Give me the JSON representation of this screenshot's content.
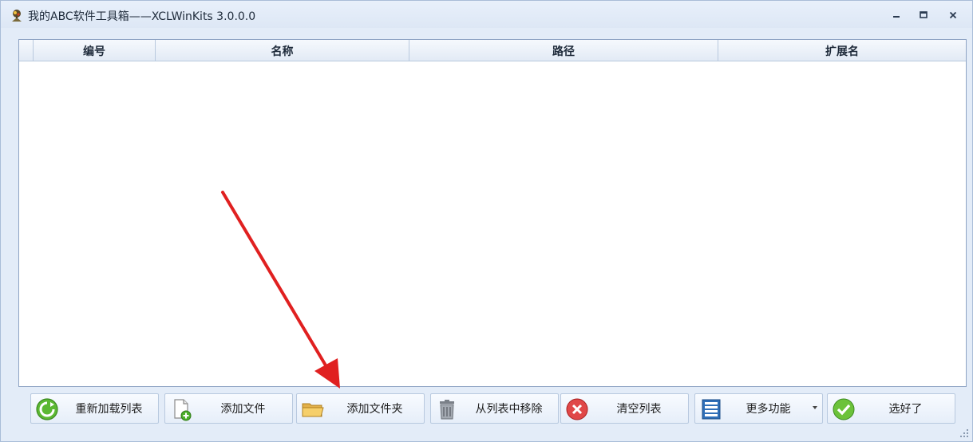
{
  "window": {
    "title": "我的ABC软件工具箱——XCLWinKits  3.0.0.0"
  },
  "grid": {
    "columns": [
      "编号",
      "名称",
      "路径",
      "扩展名"
    ],
    "rows": []
  },
  "toolbar": {
    "reload_label": "重新加载列表",
    "add_file_label": "添加文件",
    "add_folder_label": "添加文件夹",
    "remove_label": "从列表中移除",
    "clear_label": "清空列表",
    "more_label": "更多功能",
    "done_label": "选好了"
  },
  "icons": {
    "app": "app-logo-icon",
    "reload": "refresh-icon",
    "add_file": "add-file-icon",
    "add_folder": "folder-icon",
    "remove": "trash-icon",
    "clear": "clear-icon",
    "more": "list-icon",
    "done": "check-icon"
  },
  "colors": {
    "accent_red": "#e02020",
    "ok_green": "#4caf2a",
    "grid_border": "#8fa4c4",
    "window_bg": "#e3ecf8"
  }
}
